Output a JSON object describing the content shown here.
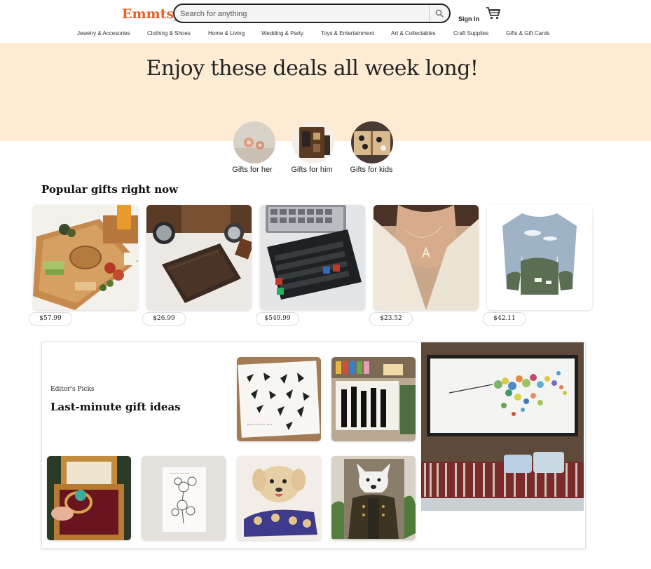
{
  "header": {
    "logo": "Emmtsy",
    "search_placeholder": "Search for anything",
    "signin": "Sign In"
  },
  "categories": [
    "Jewelry & Accesories",
    "Clothing & Shoes",
    "Home & Living",
    "Wedding & Party",
    "Toys & Entertainment",
    "Art & Collectables",
    "Craft Supplies",
    "Gifts & Gift Cards"
  ],
  "hero": {
    "title": "Enjoy these deals all week long!"
  },
  "gift_guides": [
    {
      "label": "Gifts for her"
    },
    {
      "label": "Gifts for him"
    },
    {
      "label": "Gifts for kids"
    }
  ],
  "popular": {
    "title": "Popular gifts right now",
    "items": [
      {
        "name": "charcuterie-board",
        "price": "$57.99"
      },
      {
        "name": "leather-wallet",
        "price": "$26.99"
      },
      {
        "name": "mechanical-keyboard",
        "price": "$549.99"
      },
      {
        "name": "initial-necklace",
        "price": "$23.52"
      },
      {
        "name": "sweater",
        "price": "$42.11"
      }
    ]
  },
  "editors_picks": {
    "eyebrow": "Editor's Picks",
    "title": "Last-minute gift ideas"
  }
}
